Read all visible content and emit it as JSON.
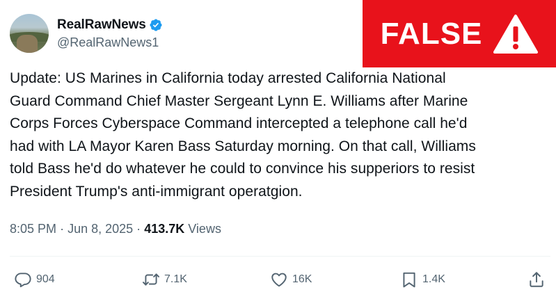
{
  "account": {
    "display_name": "RealRawNews",
    "handle": "@RealRawNews1",
    "verified": true
  },
  "badge": {
    "label": "FALSE",
    "color": "#e8121b",
    "icon": "warning-icon"
  },
  "tweet": {
    "text": "Update: US Marines in California today arrested California National\nGuard Command Chief Master Sergeant Lynn E. Williams after Marine\nCorps Forces Cyberspace Command intercepted a telephone call he'd\nhad with LA Mayor Karen Bass Saturday morning. On that call, Williams\ntold Bass he'd do whatever he could to convince his supperiors to resist\nPresident Trump's anti-immigrant operatgion.",
    "time": "8:05 PM",
    "separator": "·",
    "date": "Jun 8, 2025",
    "views_count": "413.7K",
    "views_label": "Views"
  },
  "actions": {
    "replies": "904",
    "reposts": "7.1K",
    "likes": "16K",
    "bookmarks": "1.4K"
  },
  "colors": {
    "text": "#0f1419",
    "secondary": "#536471",
    "verified": "#1d9bf0"
  }
}
